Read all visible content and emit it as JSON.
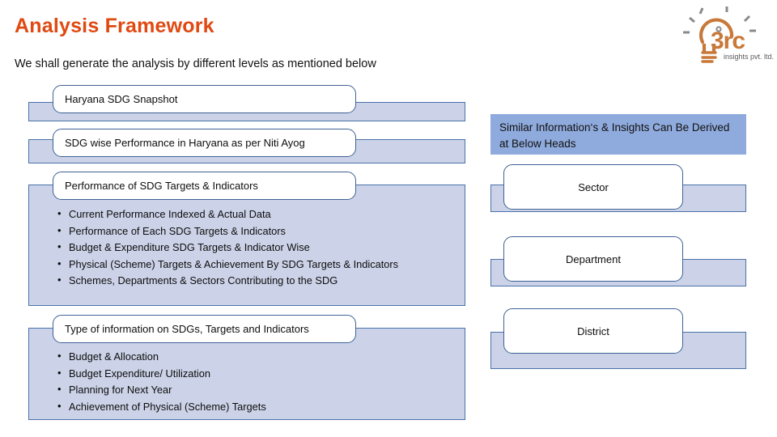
{
  "page": {
    "title": "Analysis Framework",
    "subtitle": "We shall generate the analysis by different levels as mentioned below",
    "title_color": "#E04912",
    "panel_fill": "#CCD3E8",
    "panel_border": "#4A72A8",
    "callout_border": "#3F6195",
    "header_band_fill": "#8FAADC"
  },
  "logo": {
    "name": "i3rc-logo",
    "wordmark": "i3rc",
    "tagline": "insights pvt. ltd.",
    "icon": "lightbulb-icon",
    "color": "#C8793A"
  },
  "left_column": {
    "sections": [
      {
        "id": "haryana-sdg-snapshot",
        "callout_label": "Haryana SDG Snapshot",
        "bullets": []
      },
      {
        "id": "sdg-wise-performance",
        "callout_label": "SDG wise Performance in Haryana as per Niti Ayog",
        "bullets": []
      },
      {
        "id": "performance-of-sdg-targets",
        "callout_label": "Performance of SDG Targets & Indicators",
        "bullets": [
          "Current Performance Indexed & Actual Data",
          "Performance of Each SDG Targets & Indicators",
          "Budget & Expenditure SDG Targets & Indicator Wise",
          "Physical (Scheme) Targets & Achievement By SDG Targets & Indicators",
          "Schemes, Departments & Sectors Contributing to the SDG"
        ]
      },
      {
        "id": "type-of-information",
        "callout_label": "Type of information on SDGs, Targets and Indicators",
        "bullets": [
          "Budget & Allocation",
          "Budget Expenditure/ Utilization",
          "Planning for Next Year",
          "Achievement of Physical (Scheme) Targets"
        ]
      }
    ]
  },
  "right_column": {
    "header": "Similar Information‘s & Insights Can Be Derived at Below Heads",
    "items": [
      {
        "id": "sector",
        "label": "Sector"
      },
      {
        "id": "department",
        "label": "Department"
      },
      {
        "id": "district",
        "label": "District"
      }
    ]
  }
}
